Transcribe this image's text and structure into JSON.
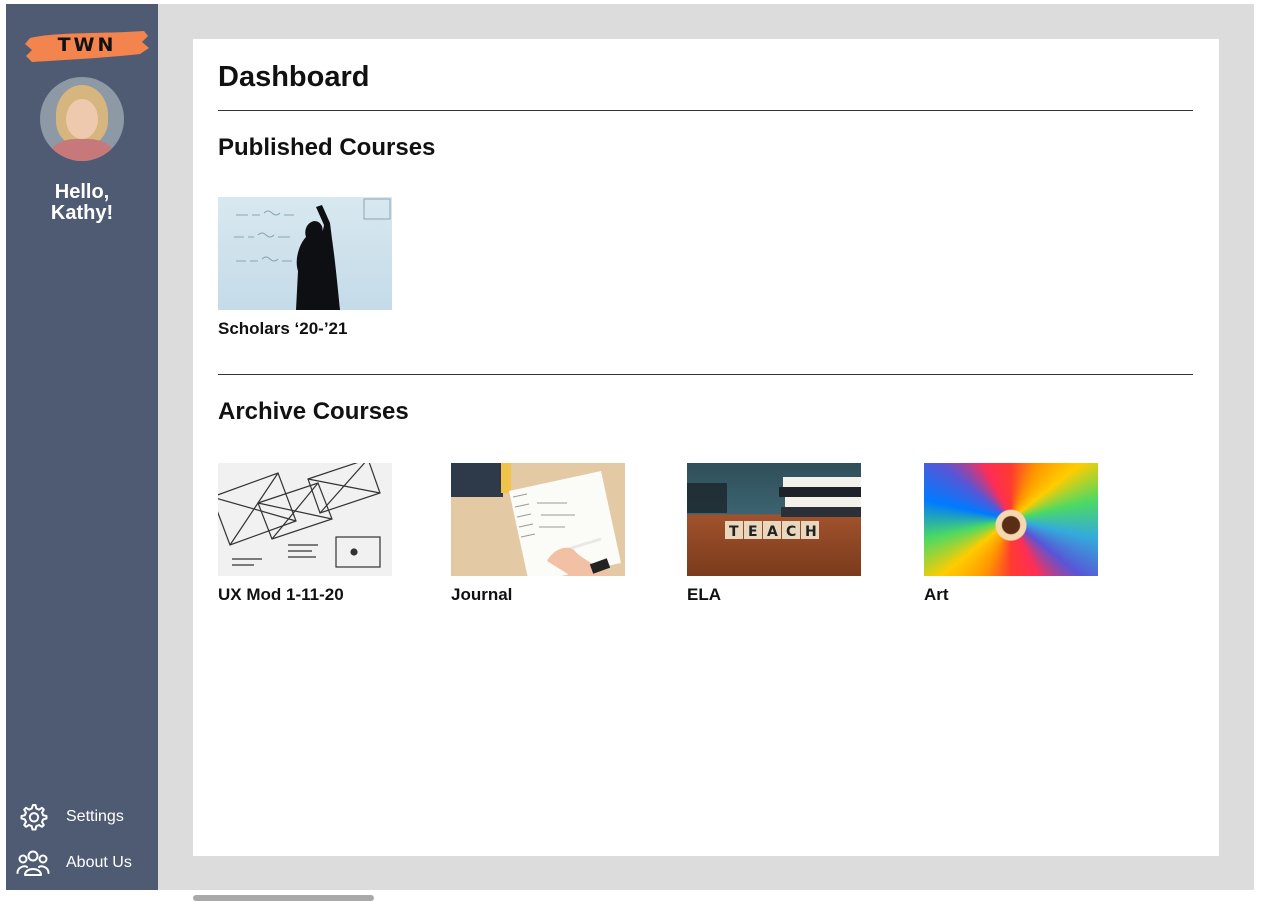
{
  "sidebar": {
    "logo_text": "TWN",
    "greeting_line1": "Hello,",
    "greeting_line2": "Kathy!",
    "settings_label": "Settings",
    "about_label": "About Us",
    "accent_color": "#f4844e",
    "background_color": "#4e5b73"
  },
  "main": {
    "title": "Dashboard",
    "published": {
      "heading": "Published Courses",
      "courses": [
        {
          "name": "Scholars ‘20-’21",
          "icon": "teacher-at-whiteboard"
        }
      ]
    },
    "archive": {
      "heading": "Archive Courses",
      "courses": [
        {
          "name": "UX Mod 1-11-20",
          "icon": "wireframe-sketch"
        },
        {
          "name": "Journal",
          "icon": "notebook-writing"
        },
        {
          "name": "ELA",
          "icon": "teach-letter-blocks",
          "blocks": "TEACH"
        },
        {
          "name": "Art",
          "icon": "colored-pencils"
        }
      ]
    }
  }
}
